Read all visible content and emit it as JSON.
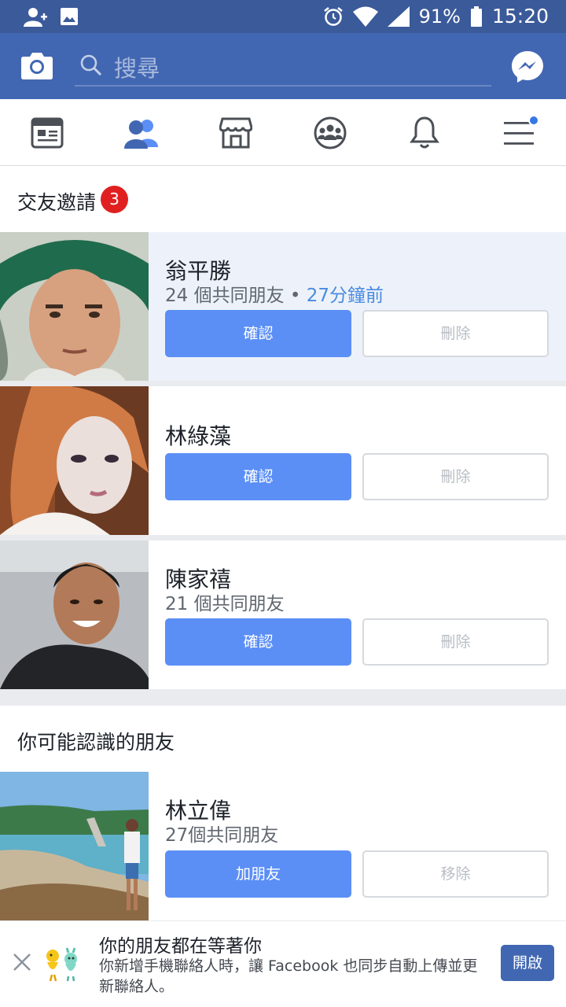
{
  "status_bar": {
    "battery": "91%",
    "time": "15:20"
  },
  "header": {
    "search_placeholder": "搜尋"
  },
  "tabs": [
    "news-feed",
    "friends",
    "marketplace",
    "groups",
    "notifications",
    "menu"
  ],
  "requests": {
    "title": "交友邀請",
    "count": "3",
    "items": [
      {
        "name": "翁平勝",
        "mutual": "24 個共同朋友",
        "separator": " • ",
        "time": "27分鐘前",
        "confirm": "確認",
        "delete": "刪除"
      },
      {
        "name": "林綠藻",
        "confirm": "確認",
        "delete": "刪除"
      },
      {
        "name": "陳家禧",
        "mutual": "21 個共同朋友",
        "confirm": "確認",
        "delete": "刪除"
      }
    ]
  },
  "suggestions": {
    "title": "你可能認識的朋友",
    "items": [
      {
        "name": "林立偉",
        "mutual": "27個共同朋友",
        "add": "加朋友",
        "remove": "移除"
      }
    ]
  },
  "banner": {
    "title": "你的朋友都在等著你",
    "body": "你新增手機聯絡人時，讓 Facebook 也同步自動上傳並更新聯絡人。",
    "button": "開啟"
  },
  "colors": {
    "brand": "#4267b2",
    "primary_button": "#5b8ff6",
    "badge": "#e02020",
    "highlight": "#edf2fa"
  }
}
